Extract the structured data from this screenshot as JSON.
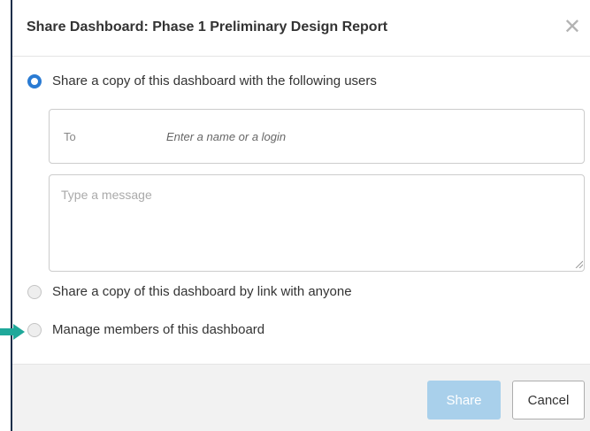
{
  "dialog": {
    "title": "Share Dashboard: Phase 1 Preliminary Design Report",
    "close_glyph": "✕"
  },
  "options": {
    "share_users": {
      "label": "Share a copy of this dashboard with the following users",
      "selected": true
    },
    "share_link": {
      "label": "Share a copy of this dashboard by link with anyone",
      "selected": false
    },
    "manage_members": {
      "label": "Manage members of this dashboard",
      "selected": false
    }
  },
  "to_field": {
    "label": "To",
    "placeholder": "Enter a name or a login",
    "value": ""
  },
  "message": {
    "placeholder": "Type a message",
    "value": ""
  },
  "footer": {
    "share_label": "Share",
    "cancel_label": "Cancel"
  },
  "colors": {
    "accent": "#2a7bd3",
    "share_button_disabled": "#a9d0eb",
    "arrow": "#1fa89a",
    "dialog_border": "#1d2e4a"
  },
  "icons": {
    "close": "close-icon",
    "resize": "resize-grip-icon",
    "pointer": "arrow-right-icon"
  }
}
